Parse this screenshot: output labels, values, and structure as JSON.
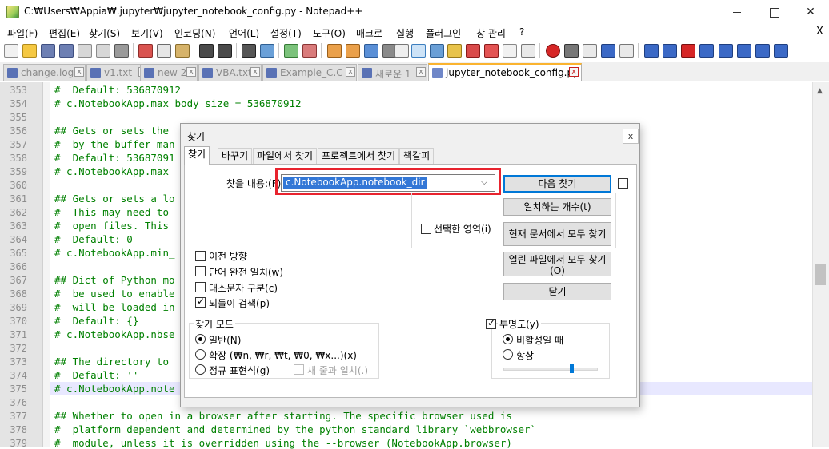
{
  "window": {
    "title": "C:₩Users₩Appia₩.jupyter₩jupyter_notebook_config.py - Notepad++",
    "minimize": "",
    "maximize": "",
    "close": "✕"
  },
  "menu": {
    "items": [
      "파일(F)",
      "편집(E)",
      "찾기(S)",
      "보기(V)",
      "인코딩(N)",
      "언어(L)",
      "설정(T)",
      "도구(O)",
      "매크로",
      "실행",
      "플러그인",
      "창 관리",
      "?"
    ],
    "close": "X"
  },
  "tabs": [
    {
      "label": "change.log",
      "active": false
    },
    {
      "label": "v1.txt",
      "active": false
    },
    {
      "label": "new 2",
      "active": false
    },
    {
      "label": "VBA.txt",
      "active": false
    },
    {
      "label": "Example_C.C",
      "active": false
    },
    {
      "label": "새로운 1",
      "active": false
    },
    {
      "label": "jupyter_notebook_config.py",
      "active": true
    }
  ],
  "editor": {
    "lines": [
      {
        "no": "353",
        "text": "#  Default: 536870912"
      },
      {
        "no": "354",
        "text": "# c.NotebookApp.max_body_size = 536870912"
      },
      {
        "no": "355",
        "text": ""
      },
      {
        "no": "356",
        "text": "## Gets or sets the"
      },
      {
        "no": "357",
        "text": "#  by the buffer man"
      },
      {
        "no": "358",
        "text": "#  Default: 53687091"
      },
      {
        "no": "359",
        "text": "# c.NotebookApp.max_"
      },
      {
        "no": "360",
        "text": ""
      },
      {
        "no": "361",
        "text": "## Gets or sets a lo"
      },
      {
        "no": "362",
        "text": "#  This may need to"
      },
      {
        "no": "363",
        "text": "#  open files. This"
      },
      {
        "no": "364",
        "text": "#  Default: 0"
      },
      {
        "no": "365",
        "text": "# c.NotebookApp.min_"
      },
      {
        "no": "366",
        "text": ""
      },
      {
        "no": "367",
        "text": "## Dict of Python mo"
      },
      {
        "no": "368",
        "text": "#  be used to enable"
      },
      {
        "no": "369",
        "text": "#  will be loaded in"
      },
      {
        "no": "370",
        "text": "#  Default: {}"
      },
      {
        "no": "371",
        "text": "# c.NotebookApp.nbse"
      },
      {
        "no": "372",
        "text": ""
      },
      {
        "no": "373",
        "text": "## The directory to"
      },
      {
        "no": "374",
        "text": "#  Default: ''"
      },
      {
        "no": "375",
        "text": "# c.NotebookApp.note"
      },
      {
        "no": "376",
        "text": ""
      },
      {
        "no": "377",
        "text": "## Whether to open in a browser after starting. The specific browser used is"
      },
      {
        "no": "378",
        "text": "#  platform dependent and determined by the python standard library `webbrowser`"
      },
      {
        "no": "379",
        "text": "#  module, unless it is overridden using the --browser (NotebookApp.browser)"
      }
    ]
  },
  "dialog": {
    "title": "찾기",
    "close": "x",
    "tabs": [
      "찾기",
      "바꾸기",
      "파일에서 찾기",
      "프로젝트에서 찾기",
      "책갈피"
    ],
    "find_label": "찾을 내용:(F)",
    "find_value": "c.NotebookApp.notebook_dir",
    "dropdown_arrow": "⌵",
    "buttons": {
      "find_next": "다음 찾기",
      "count": "일치하는 개수(t)",
      "find_all_current": "현재 문서에서 모두 찾기",
      "find_all_open_line1": "열린 파일에서 모두 찾기",
      "find_all_open_line2": "(O)",
      "close": "닫기"
    },
    "in_selection": "선택한 영역(i)",
    "options": {
      "backward": "이전 방향",
      "whole_word": "단어 완전 일치(w)",
      "match_case": "대소문자 구분(c)",
      "wrap_around": "되돌이 검색(p)"
    },
    "search_mode": {
      "title": "찾기 모드",
      "normal": "일반(N)",
      "extended": "확장 (₩n, ₩r, ₩t, ₩0, ₩x...)(x)",
      "regex": "정규 표현식(g)",
      "dot_newline": "새 줄과 일치(.)"
    },
    "transparency": {
      "title": "투명도(y)",
      "on_lose_focus": "비활성일 때",
      "always": "항상",
      "level_fraction": 0.72
    }
  },
  "colors": {
    "accent": "#0078d7",
    "selection": "#3377d6",
    "annotation_box": "#e8232e",
    "comment_text": "#008000",
    "active_tab_marker": "#fab32f"
  }
}
